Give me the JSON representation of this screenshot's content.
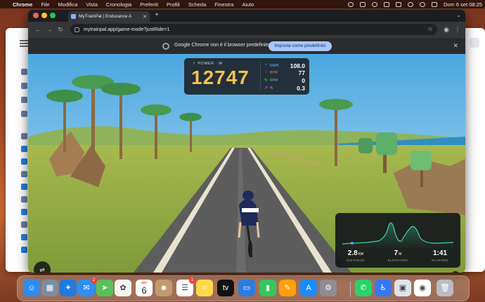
{
  "menubar": {
    "items": [
      "Chrome",
      "File",
      "Modifica",
      "Vista",
      "Cronologia",
      "Preferiti",
      "Profili",
      "Scheda",
      "Finestra",
      "Aiuto"
    ],
    "clock": "Dom 6 set  08:25"
  },
  "browser": {
    "tab_title": "MyTrainPal | Endurance A",
    "url": "mytrainpal.app/game-mode?justRide=1",
    "infobar_text": "Google Chrome non è il browser predefinito",
    "infobar_button": "Imposta come predefinito"
  },
  "hud": {
    "power_label": "POWER · W",
    "power_value": "12747",
    "metrics": [
      {
        "label": "KM/H",
        "value": "108.0",
        "color": "#6fb7ff",
        "icon": "speedometer-icon"
      },
      {
        "label": "BPM",
        "value": "77",
        "color": "#ff6b6b",
        "icon": "heart-icon"
      },
      {
        "label": "RPM",
        "value": "0",
        "color": "#4fd18b",
        "icon": "cadence-icon"
      },
      {
        "label": "%",
        "value": "0.3",
        "color": "#c38bff",
        "icon": "grade-icon"
      }
    ]
  },
  "stats": {
    "distance": {
      "value": "2.8",
      "unit": "KM",
      "label": "DISTANCE"
    },
    "elevation": {
      "value": "7",
      "unit": "M",
      "label": "ELEVATION"
    },
    "elapsed": {
      "value": "1:41",
      "label": "ELAPSED"
    }
  },
  "dock": {
    "apps": [
      {
        "name": "finder",
        "color": "#2e8cf0",
        "glyph": "☺"
      },
      {
        "name": "launchpad",
        "color": "#7d8ca3",
        "glyph": "▦"
      },
      {
        "name": "safari",
        "color": "#1f7ae0",
        "glyph": "✦"
      },
      {
        "name": "mail",
        "color": "#2d8ef5",
        "glyph": "✉",
        "badge": "2"
      },
      {
        "name": "maps",
        "color": "#5ac05a",
        "glyph": "➤"
      },
      {
        "name": "photos",
        "color": "#f4f4f4",
        "glyph": "✿"
      },
      {
        "name": "calendar",
        "color": "#ffffff",
        "month": "SET",
        "day": "6"
      },
      {
        "name": "contacts",
        "color": "#c49a6c",
        "glyph": "☻"
      },
      {
        "name": "reminders",
        "color": "#ffffff",
        "glyph": "☰",
        "badge": "1"
      },
      {
        "name": "notes",
        "color": "#ffd84a",
        "glyph": "≡"
      },
      {
        "name": "tv",
        "color": "#111111",
        "glyph": "tv"
      },
      {
        "name": "keynote",
        "color": "#2f7de0",
        "glyph": "▭"
      },
      {
        "name": "numbers",
        "color": "#34c759",
        "glyph": "▮"
      },
      {
        "name": "pages",
        "color": "#ff9f0a",
        "glyph": "✎"
      },
      {
        "name": "app-store",
        "color": "#1a8cff",
        "glyph": "A"
      },
      {
        "name": "system-settings",
        "color": "#8e8e93",
        "glyph": "⚙"
      },
      {
        "name": "whatsapp",
        "color": "#25d366",
        "glyph": "✆"
      },
      {
        "name": "accessibility",
        "color": "#3478f6",
        "glyph": "♿"
      },
      {
        "name": "preview",
        "color": "#dfe4ea",
        "glyph": "▣"
      },
      {
        "name": "chrome",
        "color": "#ffffff",
        "glyph": "◉"
      },
      {
        "name": "trash",
        "color": "#b8bcc2",
        "glyph": "🗑"
      }
    ]
  }
}
